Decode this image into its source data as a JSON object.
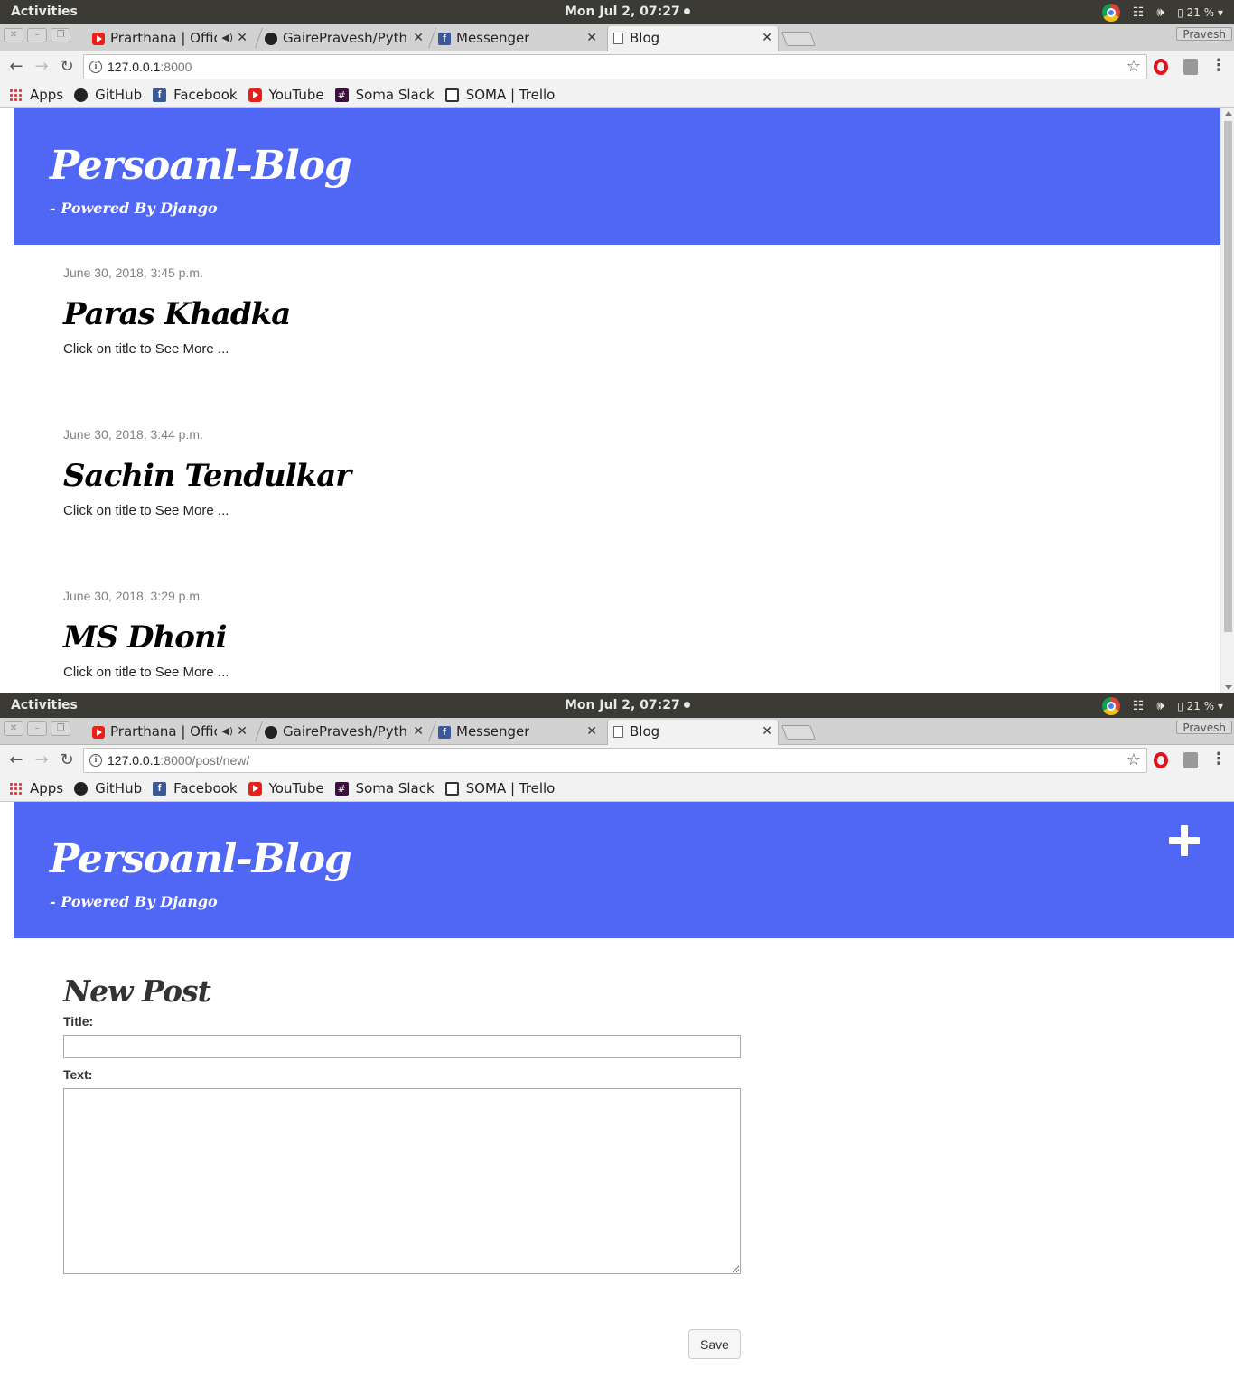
{
  "system": {
    "activities": "Activities",
    "clock": "Mon Jul  2, 07:27",
    "battery": "21 %"
  },
  "browser": {
    "profile": "Pravesh",
    "tabs": [
      {
        "title": "Prarthana | Offic",
        "favicon": "youtube-icon"
      },
      {
        "title": "GairePravesh/Pytho",
        "favicon": "github-icon"
      },
      {
        "title": "Messenger",
        "favicon": "facebook-icon"
      },
      {
        "title": "Blog",
        "favicon": "document-icon"
      }
    ],
    "bookmarks": [
      {
        "label": "Apps",
        "icon": "apps-grid-icon"
      },
      {
        "label": "GitHub",
        "icon": "github-icon"
      },
      {
        "label": "Facebook",
        "icon": "facebook-icon"
      },
      {
        "label": "YouTube",
        "icon": "youtube-icon"
      },
      {
        "label": "Soma Slack",
        "icon": "slack-icon"
      },
      {
        "label": "SOMA | Trello",
        "icon": "trello-icon"
      }
    ]
  },
  "screen1": {
    "url_host": "127.0.0.1",
    "url_rest": ":8000",
    "site_title": "Persoanl-Blog",
    "site_subtitle": "- Powered By Django",
    "posts": [
      {
        "date": "June 30, 2018, 3:45 p.m.",
        "title": "Paras Khadka",
        "excerpt": "Click on title to See More ..."
      },
      {
        "date": "June 30, 2018, 3:44 p.m.",
        "title": "Sachin Tendulkar",
        "excerpt": "Click on title to See More ..."
      },
      {
        "date": "June 30, 2018, 3:29 p.m.",
        "title": "MS Dhoni",
        "excerpt": "Click on title to See More ..."
      }
    ]
  },
  "screen2": {
    "url_host": "127.0.0.1",
    "url_rest": ":8000/post/new/",
    "site_title": "Persoanl-Blog",
    "site_subtitle": "- Powered By Django",
    "form": {
      "heading": "New Post",
      "title_label": "Title:",
      "title_value": "",
      "text_label": "Text:",
      "text_value": "",
      "save_label": "Save"
    }
  },
  "colors": {
    "header_bg": "#5067f5",
    "ubuntu_bar": "#3b3a35"
  }
}
